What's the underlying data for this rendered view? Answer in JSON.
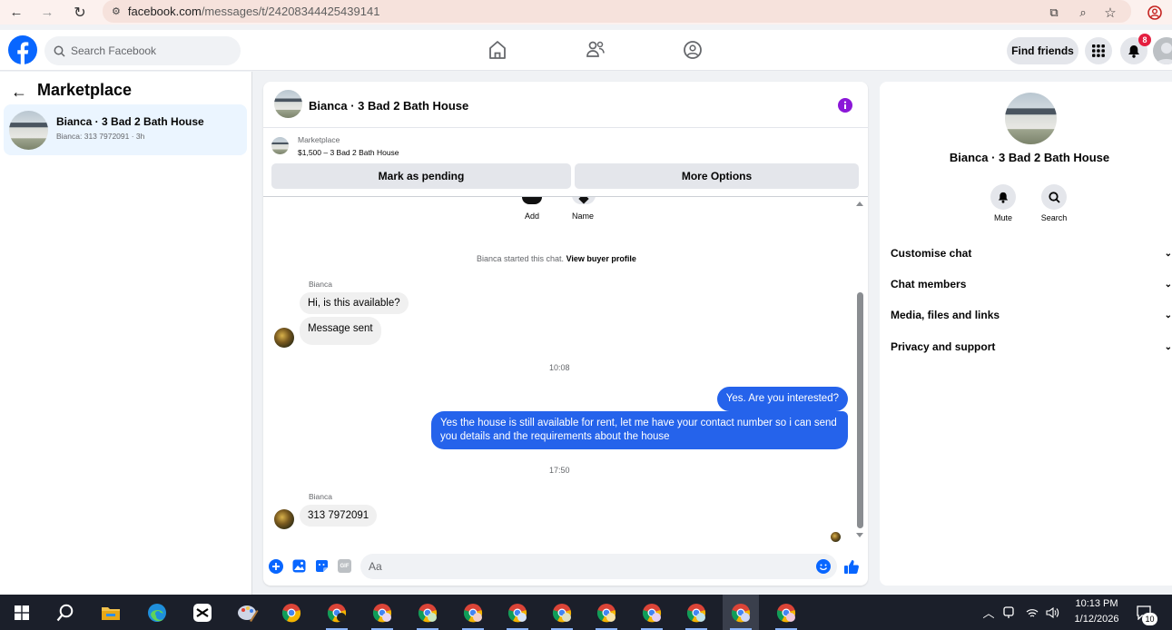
{
  "browser": {
    "url_host": "facebook.com",
    "url_path": "/messages/t/24208344425439141"
  },
  "header": {
    "search_placeholder": "Search Facebook",
    "find_friends_label": "Find friends",
    "notification_count": "8"
  },
  "sidebar": {
    "title": "Marketplace",
    "threads": [
      {
        "title": "Bianca · 3 Bad 2 Bath House",
        "subtitle": "Bianca: 313 7972091 · 3h"
      }
    ]
  },
  "chat": {
    "title": "Bianca · 3 Bad 2 Bath House",
    "listing_source": "Marketplace",
    "listing_price": "$1,500 – 3 Bad 2 Bath House",
    "mark_pending_label": "Mark as pending",
    "more_options_label": "More Options",
    "quick_actions": [
      "Add",
      "Name"
    ],
    "started_text": "Bianca started this chat.",
    "view_profile_label": "View buyer profile",
    "messages": {
      "sender_1": "Bianca",
      "in_1": "Hi, is this available?",
      "in_2": "Message sent",
      "time_1": "10:08",
      "out_1": "Yes. Are you interested?",
      "out_2": "Yes the house is still available for rent, let me have your contact number so i can send you details and the requirements about the house",
      "time_2": "17:50",
      "sender_2": "Bianca",
      "in_3": "313 7972091"
    },
    "composer_placeholder": "Aa"
  },
  "details": {
    "name": "Bianca · 3 Bad 2 Bath House",
    "mute_label": "Mute",
    "search_label": "Search",
    "sections": [
      "Customise chat",
      "Chat members",
      "Media, files and links",
      "Privacy and support"
    ]
  },
  "taskbar": {
    "time": "10:13 PM",
    "date": "1/12/2026",
    "notification_count": "10"
  },
  "colors": {
    "facebook_blue": "#0866ff",
    "outgoing_bubble": "#2563eb",
    "purple_info": "#8b17d8",
    "taskbar_bg": "#1b1f2a"
  }
}
